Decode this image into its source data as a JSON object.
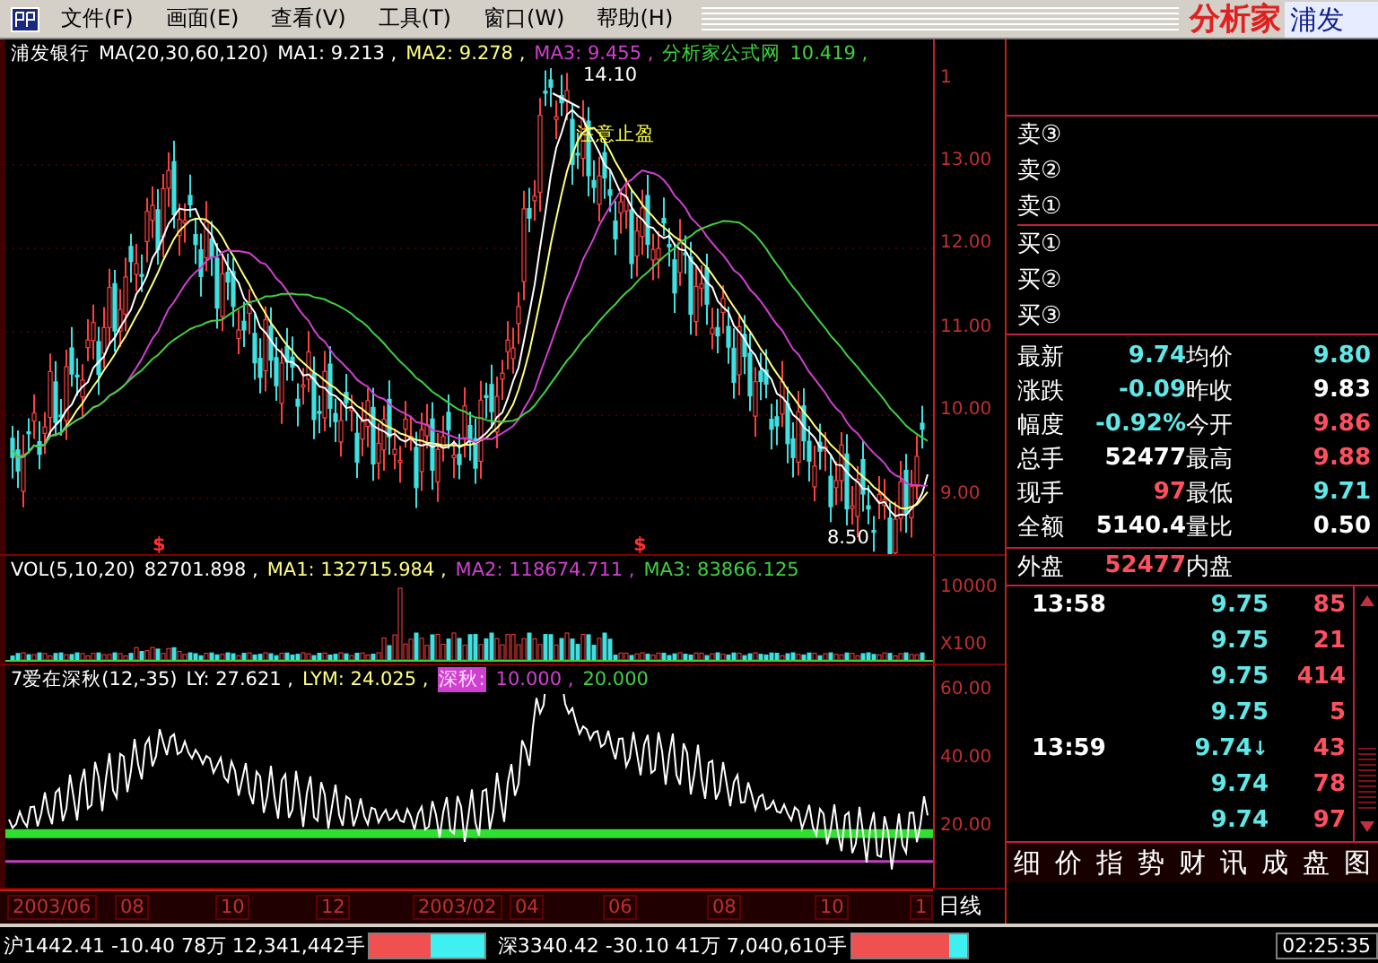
{
  "menu_bar": {
    "items": [
      {
        "label": "文件(F)"
      },
      {
        "label": "画面(E)"
      },
      {
        "label": "查看(V)"
      },
      {
        "label": "工具(T)"
      },
      {
        "label": "窗口(W)"
      },
      {
        "label": "帮助(H)"
      }
    ],
    "logo": "分析家",
    "stock_tab": "浦发"
  },
  "main_chart": {
    "legend": [
      {
        "text": "浦发银行",
        "color": "#ffffff",
        "highlighted": false
      },
      {
        "text": "MA(20,30,60,120)",
        "color": "#ffffff",
        "highlighted": false
      },
      {
        "text": "MA1: 9.213 ,",
        "color": "#ffffff",
        "highlighted": false
      },
      {
        "text": "MA2: 9.278 ,",
        "color": "#ffff80",
        "highlighted": false
      },
      {
        "text": "MA3: 9.455 ,",
        "color": "#d040d0",
        "highlighted": false
      },
      {
        "text": "分析家公式网",
        "color": "#40d040",
        "highlighted": false
      },
      {
        "text": "10.419 ,",
        "color": "#40d040",
        "highlighted": false
      }
    ],
    "annotations": [
      {
        "kind": "high",
        "text": "14.10"
      },
      {
        "kind": "note",
        "text": "注意止盈"
      },
      {
        "kind": "signal",
        "text": "$"
      },
      {
        "kind": "signal",
        "text": "$"
      },
      {
        "kind": "low",
        "text": "8.50"
      }
    ],
    "axis_labels": [
      "1",
      "13.00",
      "12.00",
      "11.00",
      "10.00",
      "9.00"
    ]
  },
  "volume_chart": {
    "legend": [
      {
        "text": "VOL(5,10,20)",
        "color": "#ffffff",
        "highlighted": false
      },
      {
        "text": "82701.898 ,",
        "color": "#ffffff",
        "highlighted": false
      },
      {
        "text": "MA1: 132715.984 ,",
        "color": "#ffff80",
        "highlighted": false
      },
      {
        "text": "MA2: 118674.711 ,",
        "color": "#d040d0",
        "highlighted": false
      },
      {
        "text": "MA3: 83866.125",
        "color": "#40d040",
        "highlighted": false
      }
    ],
    "axis_labels": [
      "10000",
      "X100"
    ]
  },
  "indicator_chart": {
    "legend": [
      {
        "text": "7爱在深秋(12,-35)",
        "color": "#ffffff",
        "highlighted": false
      },
      {
        "text": "LY: 27.621 ,",
        "color": "#ffffff",
        "highlighted": false
      },
      {
        "text": "LYM: 24.025 ,",
        "color": "#ffff80",
        "highlighted": false
      },
      {
        "text": "深秋:",
        "color": "#d040d0",
        "highlighted": true
      },
      {
        "text": "10.000 ,",
        "color": "#d040d0",
        "highlighted": false
      },
      {
        "text": "20.000",
        "color": "#40d040",
        "highlighted": false
      }
    ],
    "axis_labels": [
      "60.00",
      "40.00",
      "20.00"
    ]
  },
  "date_axis": {
    "labels": [
      "2003/06",
      "08",
      "10",
      "12",
      "2003/02",
      "04",
      "06",
      "08",
      "10",
      "1"
    ],
    "period": "日线"
  },
  "order_book": [
    {
      "label": "卖③"
    },
    {
      "label": "卖②"
    },
    {
      "label": "卖①"
    },
    {
      "label": "买①"
    },
    {
      "label": "买②"
    },
    {
      "label": "买③"
    }
  ],
  "quote": [
    {
      "label": "最新",
      "value": "9.74",
      "color": "#60e8e8"
    },
    {
      "label": "均价",
      "value": "9.80",
      "color": "#60e8e8"
    },
    {
      "label": "涨跌",
      "value": "-0.09",
      "color": "#60e8e8"
    },
    {
      "label": "昨收",
      "value": "9.83",
      "color": "#ffffff"
    },
    {
      "label": "幅度",
      "value": "-0.92%",
      "color": "#60e8e8"
    },
    {
      "label": "今开",
      "value": "9.86",
      "color": "#ff5060"
    },
    {
      "label": "总手",
      "value": "52477",
      "color": "#ffffff"
    },
    {
      "label": "最高",
      "value": "9.88",
      "color": "#ff5060"
    },
    {
      "label": "现手",
      "value": "97",
      "color": "#ff5060"
    },
    {
      "label": "最低",
      "value": "9.71",
      "color": "#60e8e8"
    },
    {
      "label": "全额",
      "value": "5140.4",
      "color": "#ffffff"
    },
    {
      "label": "量比",
      "value": "0.50",
      "color": "#ffffff"
    }
  ],
  "outer_inner": {
    "label": "外盘",
    "value": "52477",
    "label2": "内盘"
  },
  "ticks": [
    {
      "time": "13:58",
      "price": "9.75",
      "volume": "85"
    },
    {
      "price": "9.75",
      "volume": "21"
    },
    {
      "price": "9.75",
      "volume": "414"
    },
    {
      "price": "9.75",
      "volume": "5"
    },
    {
      "time": "13:59",
      "price": "9.74",
      "arrow": "↓",
      "volume": "43"
    },
    {
      "price": "9.74",
      "volume": "78"
    },
    {
      "price": "9.74",
      "volume": "97"
    }
  ],
  "tabs": [
    "细",
    "价",
    "指",
    "势",
    "财",
    "讯",
    "成",
    "盘",
    "图"
  ],
  "status_bar": {
    "indices": [
      {
        "text": "沪1442.41 -10.40 78万 12,341,442手",
        "level": 0.53
      },
      {
        "text": "深3340.42 -30.10 41万 7,040,610手",
        "level": 0.85
      }
    ],
    "time": "02:25:35"
  }
}
